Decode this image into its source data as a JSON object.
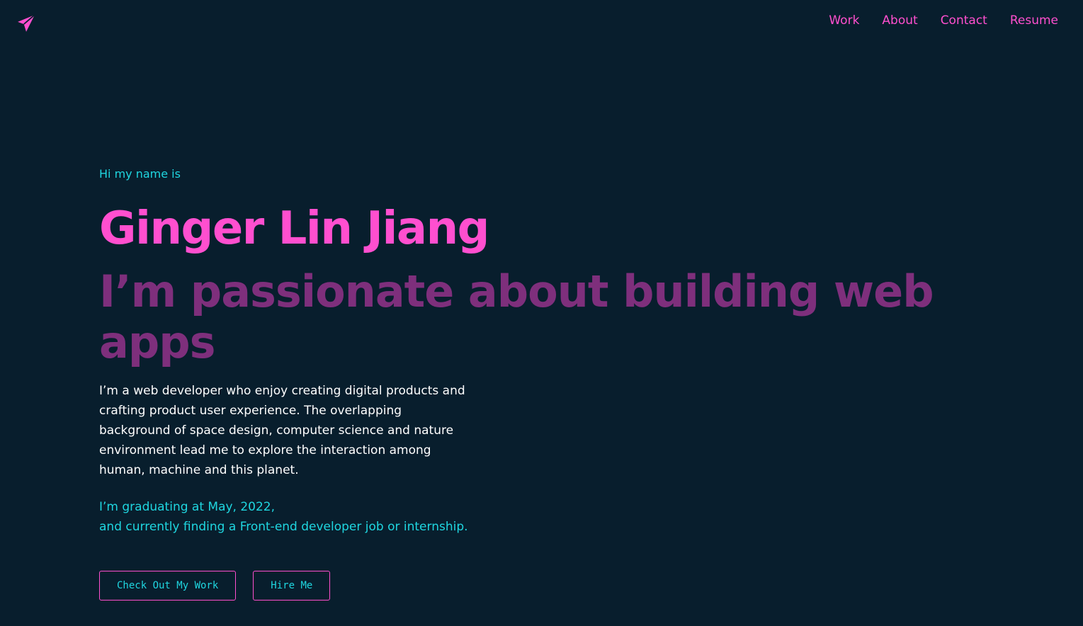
{
  "colors": {
    "background": "#081e2d",
    "accent_pink": "#ff4fcf",
    "muted_purple": "#7e2f7c",
    "cyan": "#1fd6e0",
    "body_text": "#ffffff"
  },
  "logo": {
    "icon": "paper-plane-icon"
  },
  "nav": {
    "items": [
      {
        "label": "Work"
      },
      {
        "label": "About"
      },
      {
        "label": "Contact"
      },
      {
        "label": "Resume"
      }
    ]
  },
  "hero": {
    "greeting": "Hi my name is",
    "name": "Ginger Lin Jiang",
    "tagline": "I’m passionate about building web apps",
    "bio": "I’m a web developer who enjoy creating digital products and crafting product user experience. The overlapping background of space design, computer science and nature environment lead me to explore the interaction among human, machine and this planet.",
    "status_line1": "I’m graduating at May, 2022,",
    "status_line2": "and currently finding a Front-end developer job or internship."
  },
  "actions": {
    "primary_label": "Check Out My Work",
    "secondary_label": "Hire Me"
  }
}
